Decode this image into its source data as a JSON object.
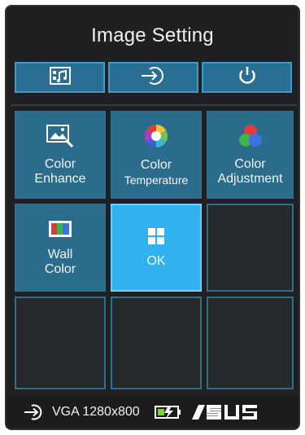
{
  "header": {
    "title": "Image Setting"
  },
  "topbar": {
    "buttons": [
      {
        "icon": "image-setting-icon"
      },
      {
        "icon": "input-source-icon"
      },
      {
        "icon": "power-icon"
      }
    ]
  },
  "tiles": [
    {
      "line1": "Color",
      "line2": "Enhance",
      "icon": "image-enhance-icon"
    },
    {
      "line1": "Color",
      "line2": "Temperature",
      "icon": "color-wheel-icon"
    },
    {
      "line1": "Color",
      "line2": "Adjustment",
      "icon": "rgb-circles-icon"
    },
    {
      "line1": "Wall",
      "line2": "Color",
      "icon": "wall-color-icon"
    },
    {
      "line1": "OK",
      "icon": "grid-icon"
    }
  ],
  "status": {
    "source_text": "VGA 1280x800",
    "source_icon": "input-source-icon",
    "battery_icon": "battery-charging-icon",
    "brand": "ASUS"
  },
  "colors": {
    "tile": "#2b6c8c",
    "tile_selected": "#32b1f0",
    "empty": "#25292c",
    "background": "#1e2022"
  }
}
